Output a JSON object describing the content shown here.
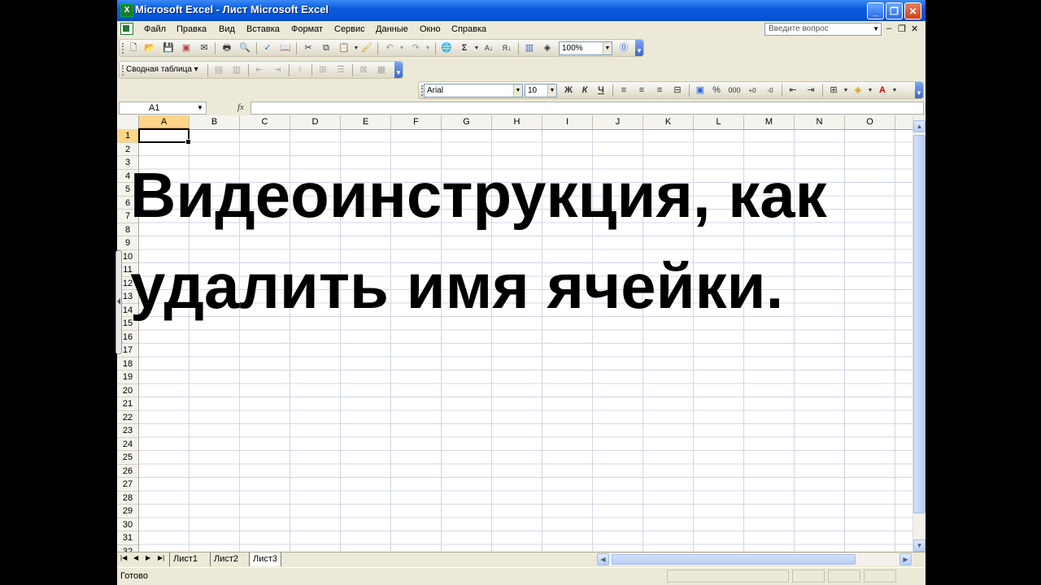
{
  "window": {
    "title": "Microsoft Excel - Лист Microsoft Excel",
    "app_icon": "X",
    "minimize": "_",
    "restore": "❐",
    "close": "✕"
  },
  "menubar": {
    "items": [
      "Файл",
      "Правка",
      "Вид",
      "Вставка",
      "Формат",
      "Сервис",
      "Данные",
      "Окно",
      "Справка"
    ],
    "help_placeholder": "Введите вопрос",
    "mdi_minimize": "–",
    "mdi_restore": "❐",
    "mdi_close": "✕"
  },
  "toolbar_standard": {
    "zoom": "100%"
  },
  "toolbar_pivot": {
    "label": "Сводная таблица ▾"
  },
  "toolbar_format": {
    "font": "Arial",
    "size": "10",
    "bold": "Ж",
    "italic": "К",
    "underline": "Ч",
    "percent": "%",
    "thousands": "000"
  },
  "formula_bar": {
    "name_box": "A1",
    "fx": "fx",
    "value": ""
  },
  "sheet": {
    "columns": [
      "A",
      "B",
      "C",
      "D",
      "E",
      "F",
      "G",
      "H",
      "I",
      "J",
      "K",
      "L",
      "M",
      "N",
      "O"
    ],
    "rows": [
      "1",
      "2",
      "3",
      "4",
      "5",
      "6",
      "7",
      "8",
      "9",
      "10",
      "11",
      "12",
      "13",
      "14",
      "15",
      "16",
      "17",
      "18",
      "19",
      "20",
      "21",
      "22",
      "23",
      "24",
      "25",
      "26",
      "27",
      "28",
      "29",
      "30",
      "31",
      "32"
    ],
    "active_cell": "A1"
  },
  "overlay_text": {
    "line1": "Видеоинструкция, как",
    "line2": "удалить имя ячейки."
  },
  "sheet_tabs": [
    "Лист1",
    "Лист2",
    "Лист3"
  ],
  "active_tab": "Лист3",
  "status": {
    "text": "Готово"
  },
  "icons": [
    "excel-app-icon",
    "new-icon",
    "open-icon",
    "save-icon",
    "permission-icon",
    "print-icon",
    "print-preview-icon",
    "spelling-icon",
    "research-icon",
    "cut-icon",
    "copy-icon",
    "paste-icon",
    "format-painter-icon",
    "undo-icon",
    "redo-icon",
    "hyperlink-icon",
    "autosum-icon",
    "sort-asc-icon",
    "sort-desc-icon",
    "chart-wizard-icon",
    "drawing-icon",
    "help-icon"
  ]
}
